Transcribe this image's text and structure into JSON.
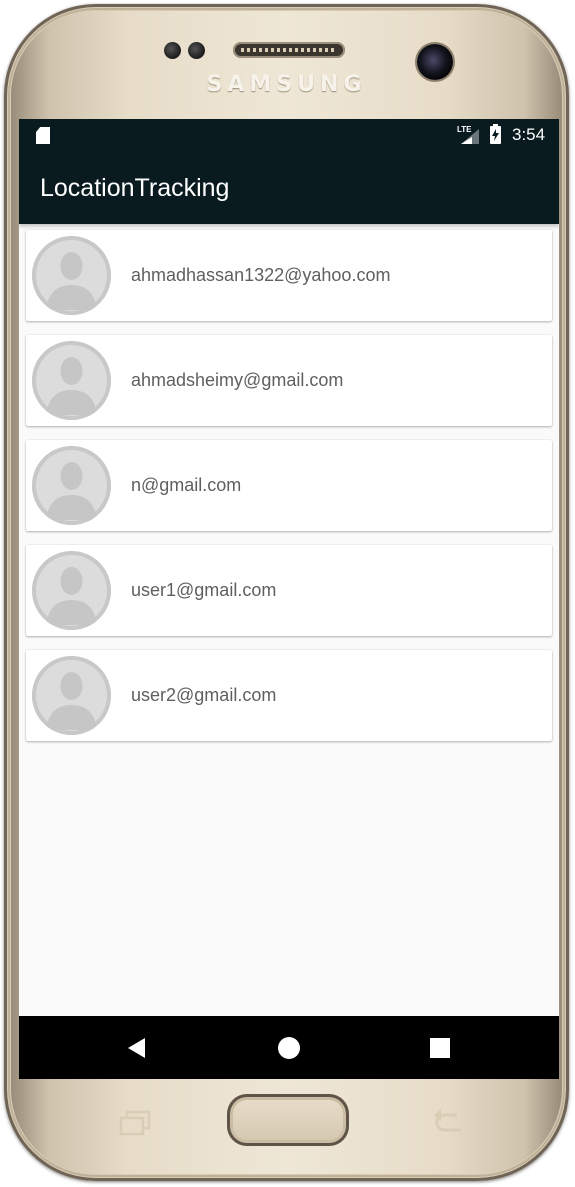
{
  "device": {
    "brand": "SAMSUNG"
  },
  "status_bar": {
    "network": "LTE",
    "time": "3:54"
  },
  "app_bar": {
    "title": "LocationTracking"
  },
  "users": [
    {
      "email": "ahmadhassan1322@yahoo.com"
    },
    {
      "email": "ahmadsheimy@gmail.com"
    },
    {
      "email": "n@gmail.com"
    },
    {
      "email": "user1@gmail.com"
    },
    {
      "email": "user2@gmail.com"
    }
  ],
  "icons": {
    "avatar": "default-person-avatar",
    "nav_back": "triangle-back-icon",
    "nav_home": "circle-home-icon",
    "nav_recents": "square-recents-icon"
  },
  "colors": {
    "app_bar": "#0a1b20",
    "background": "#fafafa",
    "card": "#ffffff",
    "email_text": "#5f5f5f",
    "nav_bar": "#000000"
  }
}
